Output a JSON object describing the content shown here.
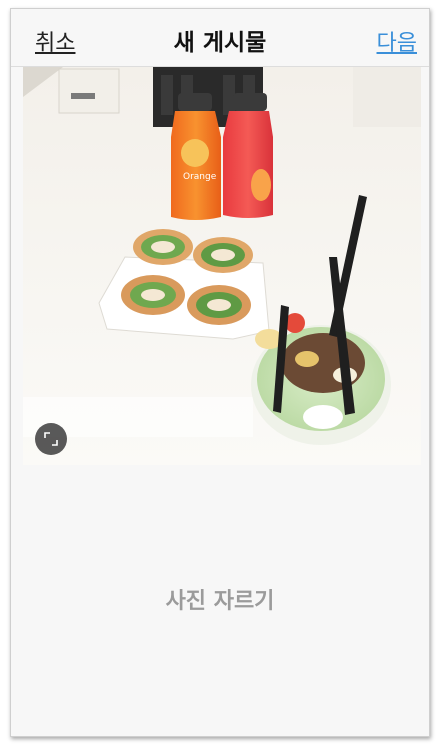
{
  "header": {
    "cancel_label": "취소",
    "title": "새 게시물",
    "next_label": "다음"
  },
  "photo": {
    "expand_icon": "expand-icon"
  },
  "footer": {
    "crop_label": "사진 자르기"
  },
  "colors": {
    "accent": "#3a8fd9",
    "muted_text": "#9b9b9b",
    "background": "#f7f7f7"
  }
}
